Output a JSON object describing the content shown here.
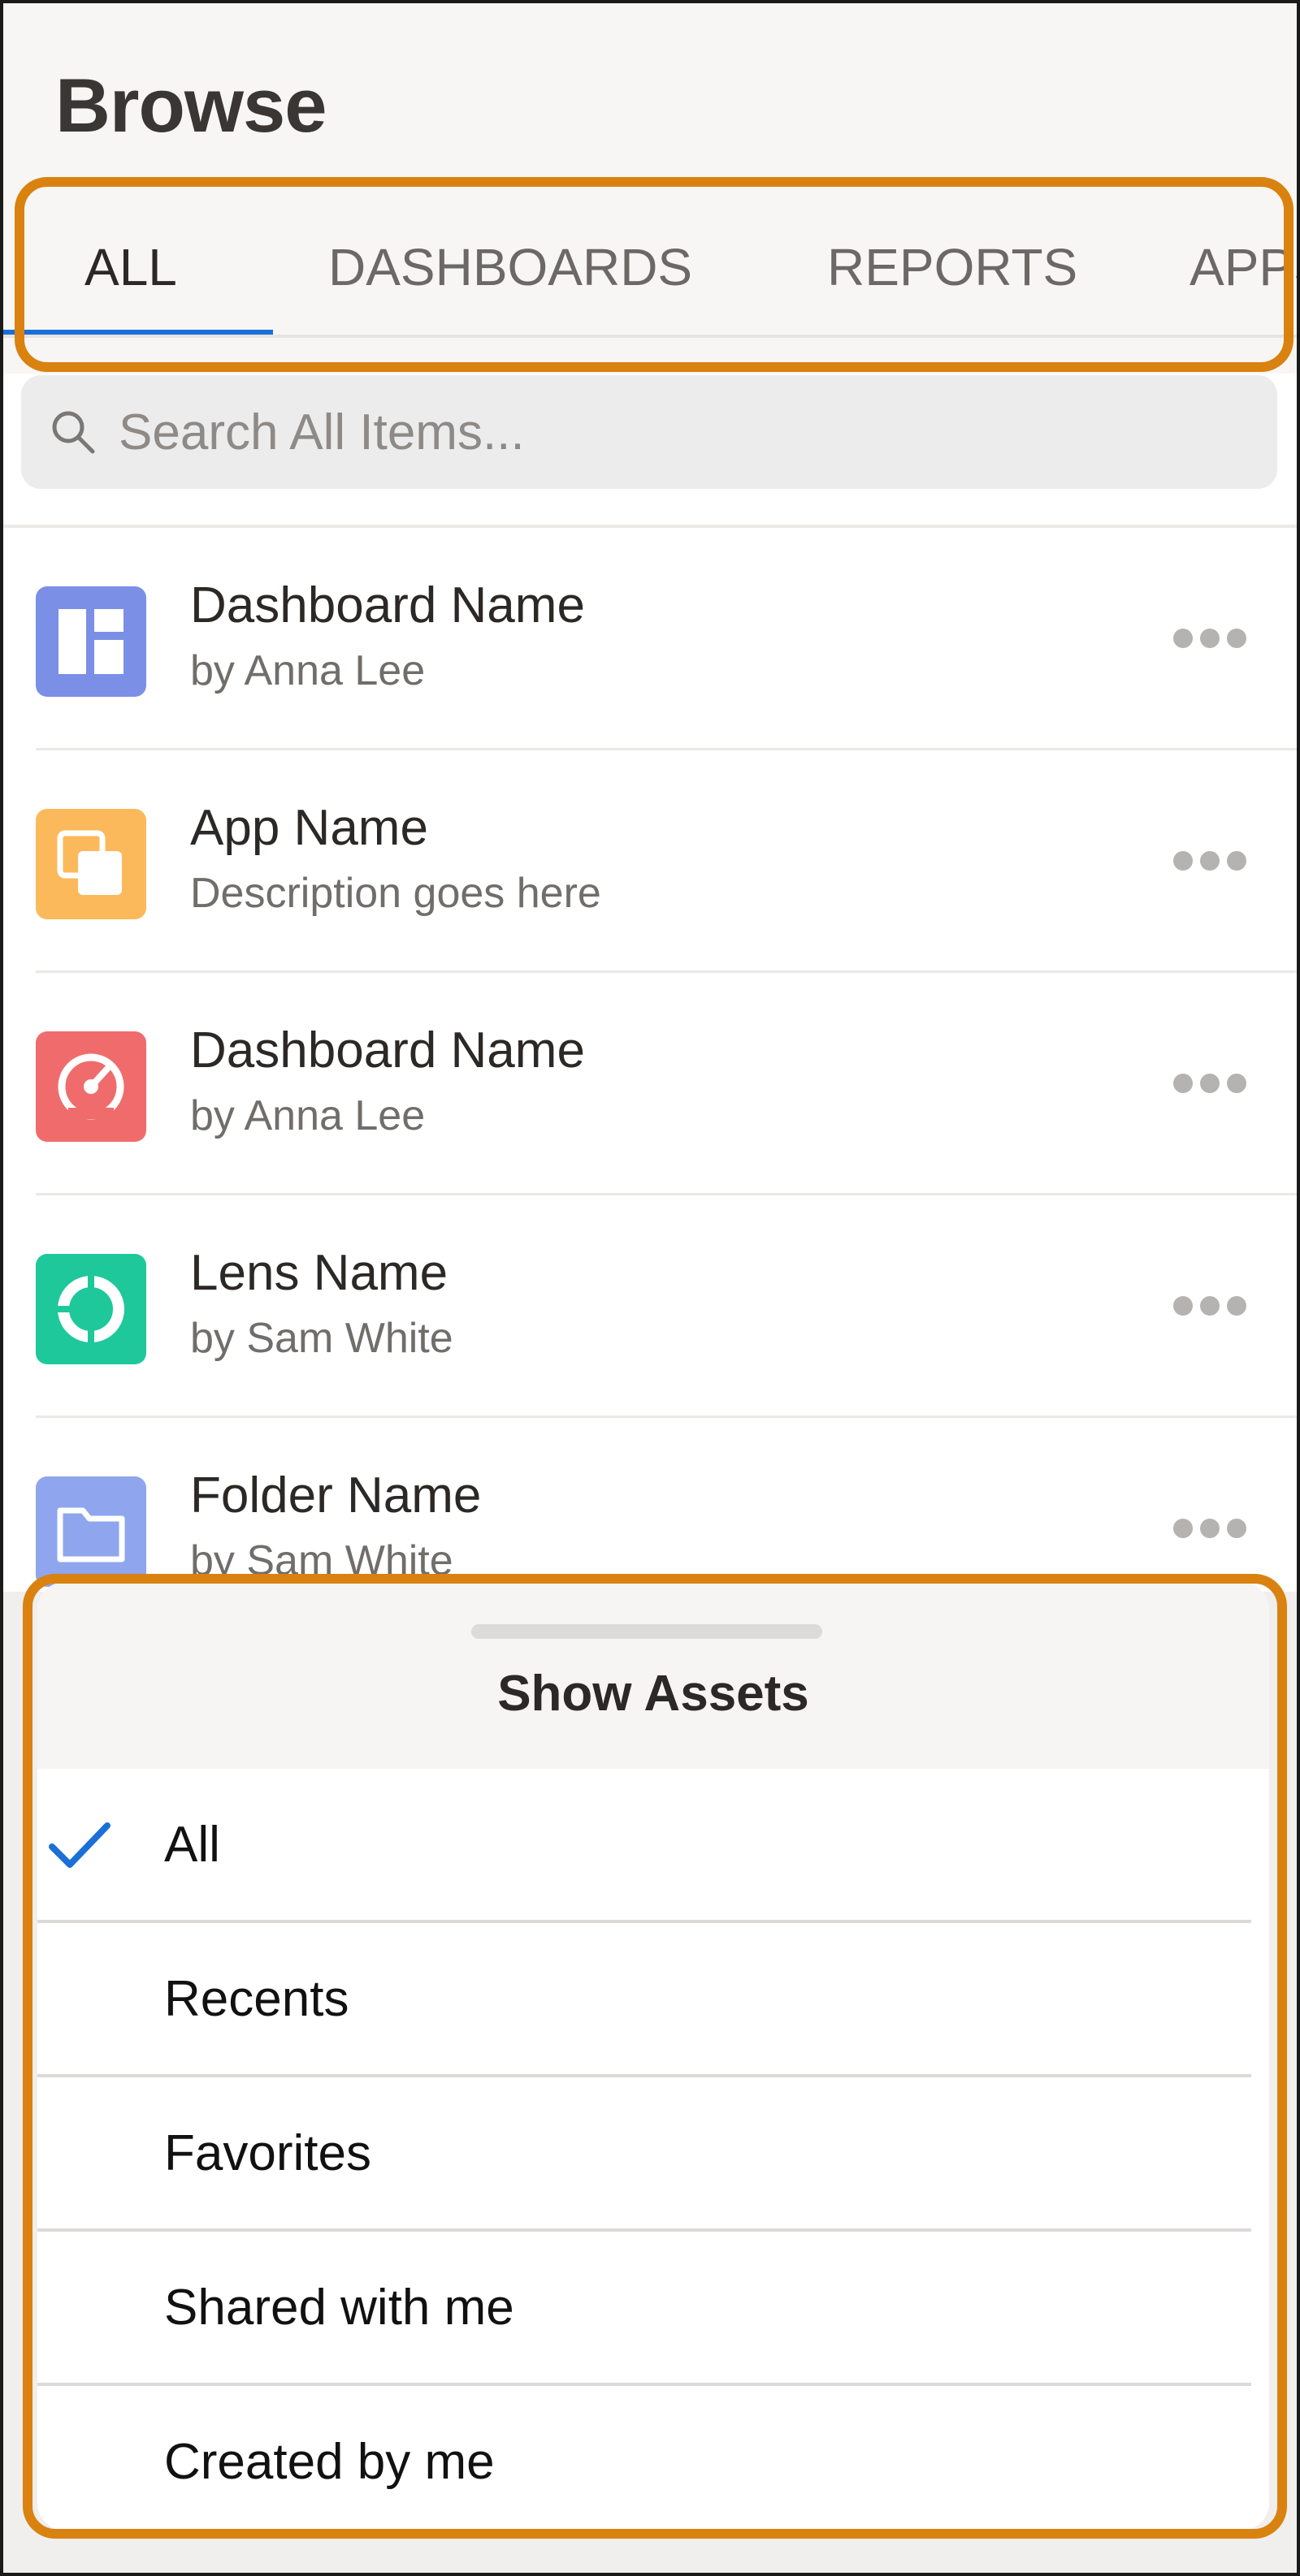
{
  "page": {
    "title": "Browse"
  },
  "tabs": [
    {
      "label": "ALL",
      "active": true
    },
    {
      "label": "DASHBOARDS",
      "active": false
    },
    {
      "label": "REPORTS",
      "active": false
    },
    {
      "label": "APPS",
      "active": false
    }
  ],
  "search": {
    "placeholder": "Search All Items...",
    "value": "",
    "icon": "search-icon"
  },
  "items": [
    {
      "title": "Dashboard Name",
      "subtitle": "by Anna Lee",
      "icon": "dashboard-layout-icon",
      "color": "#7b8fe6"
    },
    {
      "title": "App Name",
      "subtitle": "Description goes here",
      "icon": "app-icon",
      "color": "#fcb95b"
    },
    {
      "title": "Dashboard Name",
      "subtitle": "by Anna Lee",
      "icon": "gauge-icon",
      "color": "#f06c6c"
    },
    {
      "title": "Lens Name",
      "subtitle": "by Sam White",
      "icon": "lens-icon",
      "color": "#1ec89a"
    },
    {
      "title": "Folder Name",
      "subtitle": "by Sam White",
      "icon": "folder-icon",
      "color": "#8fa5ee"
    }
  ],
  "sheet": {
    "title": "Show Assets",
    "options": [
      {
        "label": "All",
        "selected": true
      },
      {
        "label": "Recents",
        "selected": false
      },
      {
        "label": "Favorites",
        "selected": false
      },
      {
        "label": "Shared with me",
        "selected": false
      },
      {
        "label": "Created by me",
        "selected": false
      }
    ]
  },
  "colors": {
    "accent": "#1b6fd8",
    "highlight": "#d9820f"
  }
}
